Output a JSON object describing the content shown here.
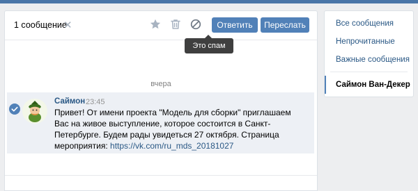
{
  "toolbar": {
    "selection_count": "1 сообщение",
    "clear_symbol": "✕",
    "reply_label": "Ответить",
    "forward_label": "Переслать",
    "spam_tooltip": "Это спам"
  },
  "chat": {
    "date_separator": "вчера",
    "message": {
      "author": "Саймон",
      "time": "23:45",
      "text": "Привет! От имени проекта \"Модель для сборки\" приглашаем Вас на живое выступление, которое состоится в Санкт-Петербурге. Будем рады увидеться 27 октября. Страница мероприятия: ",
      "link": "https://vk.com/ru_mds_20181027"
    }
  },
  "sidebar": {
    "items": [
      {
        "label": "Все сообщения"
      },
      {
        "label": "Непрочитанные"
      },
      {
        "label": "Важные сообщения"
      },
      {
        "label": "Саймон Ван-Декер"
      }
    ]
  },
  "colors": {
    "accent": "#5181b8",
    "link": "#2a5885",
    "selected_bg": "#edf0f5"
  }
}
